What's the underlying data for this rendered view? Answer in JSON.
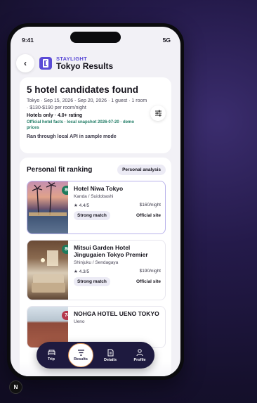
{
  "status": {
    "time": "9:41",
    "network": "5G"
  },
  "header": {
    "brand": "STAYLIGHT",
    "title": "Tokyo Results"
  },
  "summary": {
    "heading": "5 hotel candidates found",
    "meta": "Tokyo · Sep 15, 2026 - Sep 20, 2026 · 1 guest · 1 room · $130-$190 per room/night",
    "rating": "Hotels only · 4.0+ rating",
    "facts": "Official hotel facts · local snapshot 2026-07-20 · demo prices",
    "ran": "Ran through local API in sample mode"
  },
  "ranking": {
    "title": "Personal fit ranking",
    "analysis_label": "Personal analysis",
    "hotels": [
      {
        "score": "86",
        "name": "Hotel Niwa Tokyo",
        "area": "Kanda / Suidobashi",
        "rating": "4.4/5",
        "price": "$160/night",
        "match": "Strong match",
        "site": "Official site"
      },
      {
        "score": "86",
        "name": "Mitsui Garden Hotel Jingugaien Tokyo Premier",
        "area": "Shinjuku / Sendagaya",
        "rating": "4.3/5",
        "price": "$190/night",
        "match": "Strong match",
        "site": "Official site"
      },
      {
        "score": "74",
        "name": "NOHGA HOTEL UENO TOKYO",
        "area": "Ueno"
      }
    ]
  },
  "tabs": [
    {
      "label": "Trip",
      "icon": "bed-icon"
    },
    {
      "label": "Results",
      "icon": "filter-lines-icon"
    },
    {
      "label": "Details",
      "icon": "document-icon"
    },
    {
      "label": "Profile",
      "icon": "person-icon"
    }
  ],
  "badge": "N",
  "colors": {
    "accent": "#5b4bd6",
    "score_green": "#1e7a5c",
    "score_red": "#b5384c",
    "tabbar": "#1e1a3f"
  }
}
